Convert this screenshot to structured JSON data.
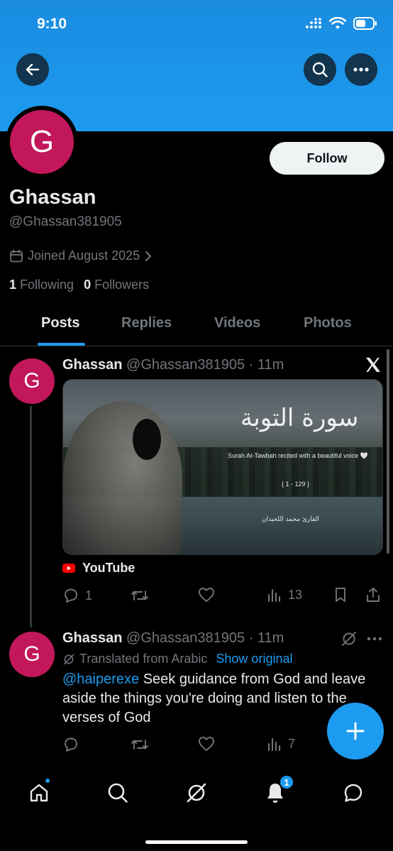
{
  "status_bar": {
    "time": "9:10"
  },
  "profile": {
    "avatar_initial": "G",
    "name": "Ghassan",
    "handle": "@Ghassan381905",
    "joined": "Joined August 2025",
    "following_count": "1",
    "following_label": "Following",
    "followers_count": "0",
    "followers_label": "Followers",
    "follow_label": "Follow"
  },
  "tabs": [
    {
      "label": "Posts",
      "active": true
    },
    {
      "label": "Replies",
      "active": false
    },
    {
      "label": "Videos",
      "active": false
    },
    {
      "label": "Photos",
      "active": false
    }
  ],
  "posts": [
    {
      "avatar_initial": "G",
      "name": "Ghassan",
      "handle_time": "@Ghassan381905 · 11m",
      "media": {
        "title_ar": "سورة التوبة",
        "subtitle": "Surah At-Tawbah recited with a beautiful voice 🤍",
        "range": "{ 1 - 129 }",
        "reciter": "القارئ محمد اللحيدان"
      },
      "link_source": "YouTube",
      "replies": "1",
      "reposts": "",
      "likes": "",
      "views": "13"
    },
    {
      "avatar_initial": "G",
      "name": "Ghassan",
      "handle_time": "@Ghassan381905 · 11m",
      "translated_label": "Translated from Arabic",
      "show_original": "Show original",
      "mention": "@haiperexe",
      "text": " Seek guidance from God and leave aside the things you're doing and listen to the verses of God",
      "replies": "",
      "reposts": "",
      "likes": "",
      "views": "7"
    }
  ],
  "bottom_nav": {
    "notifications_badge": "1"
  },
  "colors": {
    "accent": "#1d9bf0",
    "avatar": "#c2185b",
    "background": "#000000"
  }
}
